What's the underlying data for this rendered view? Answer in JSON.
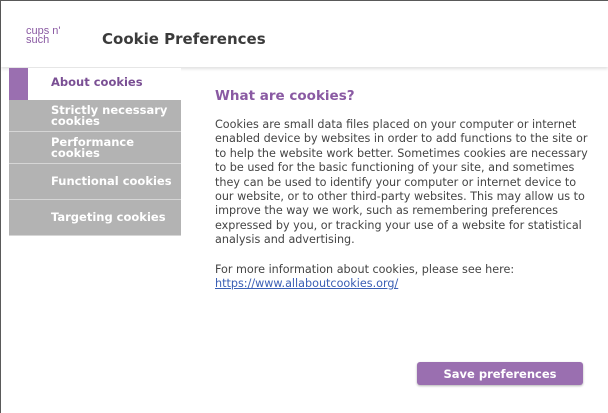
{
  "brand": {
    "logo_line1": "cups n'",
    "logo_line2": "such"
  },
  "header": {
    "title": "Cookie Preferences"
  },
  "sidebar": {
    "items": [
      {
        "label": "About cookies"
      },
      {
        "label_line1": "Strictly necessary",
        "label_line2": "cookies"
      },
      {
        "label_line1": "Performance",
        "label_line2": "cookies"
      },
      {
        "label": "Functional cookies"
      },
      {
        "label": "Targeting cookies"
      }
    ]
  },
  "main": {
    "heading": "What are cookies?",
    "body": "Cookies are small data files placed on your computer or internet enabled device by websites in order to add functions to the site or to help the website work better. Sometimes cookies are necessary to be used for the basic functioning of your site, and sometimes they can be used to identify your computer or internet device to our website, or to other third-party websites. This may allow us to improve the way we work, such as remembering preferences expressed by you, or tracking your use of a website for statistical analysis and advertising.",
    "more_info": "For more information about cookies, please see here:",
    "link": "https://www.allaboutcookies.org/"
  },
  "footer": {
    "save_label": "Save preferences"
  },
  "colors": {
    "accent": "#9a6fb0",
    "tab_gray": "#b3b3b3",
    "link": "#3a5fb5"
  }
}
